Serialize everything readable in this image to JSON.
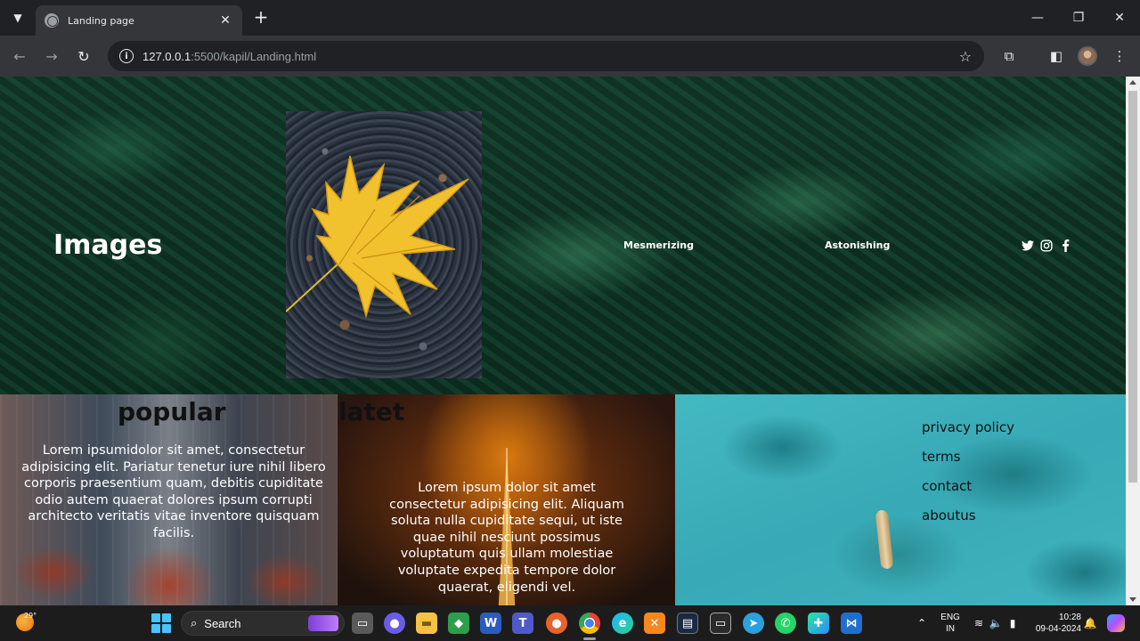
{
  "browser": {
    "tab_title": "Landing page",
    "url_host": "127.0.0.1",
    "url_rest": ":5500/kapil/Landing.html"
  },
  "hero": {
    "title": "Images",
    "links": [
      "Mesmerizing",
      "Astonishing"
    ],
    "social_icons": [
      "twitter-icon",
      "instagram-icon",
      "facebook-icon"
    ]
  },
  "cards": {
    "popular": {
      "heading": "popular",
      "text": "Lorem ipsumidolor sit amet, consectetur adipisicing elit. Pariatur tenetur iure nihil libero corporis praesentium quam, debitis cupiditate odio autem quaerat dolores ipsum corrupti architecto veritatis vitae inventore quisquam facilis."
    },
    "latest": {
      "heading": "latet",
      "text": "Lorem ipsum dolor sit amet consectetur adipisicing elit. Aliquam soluta nulla cupiditate sequi, ut iste quae nihil nesciunt possimus voluptatum quis ullam molestiae voluptate expedita tempore dolor quaerat, eligendi vel."
    },
    "footer_links": [
      "privacy policy",
      "terms",
      "contact",
      "aboutus"
    ]
  },
  "taskbar": {
    "weather_temp": "29°",
    "search_label": "Search",
    "lang_line1": "ENG",
    "lang_line2": "IN",
    "time": "10:28",
    "date": "09-04-2024"
  },
  "colors": {
    "chrome_bg": "#202124",
    "toolbar_bg": "#35363a",
    "taskbar_bg": "#1c1c1c"
  }
}
